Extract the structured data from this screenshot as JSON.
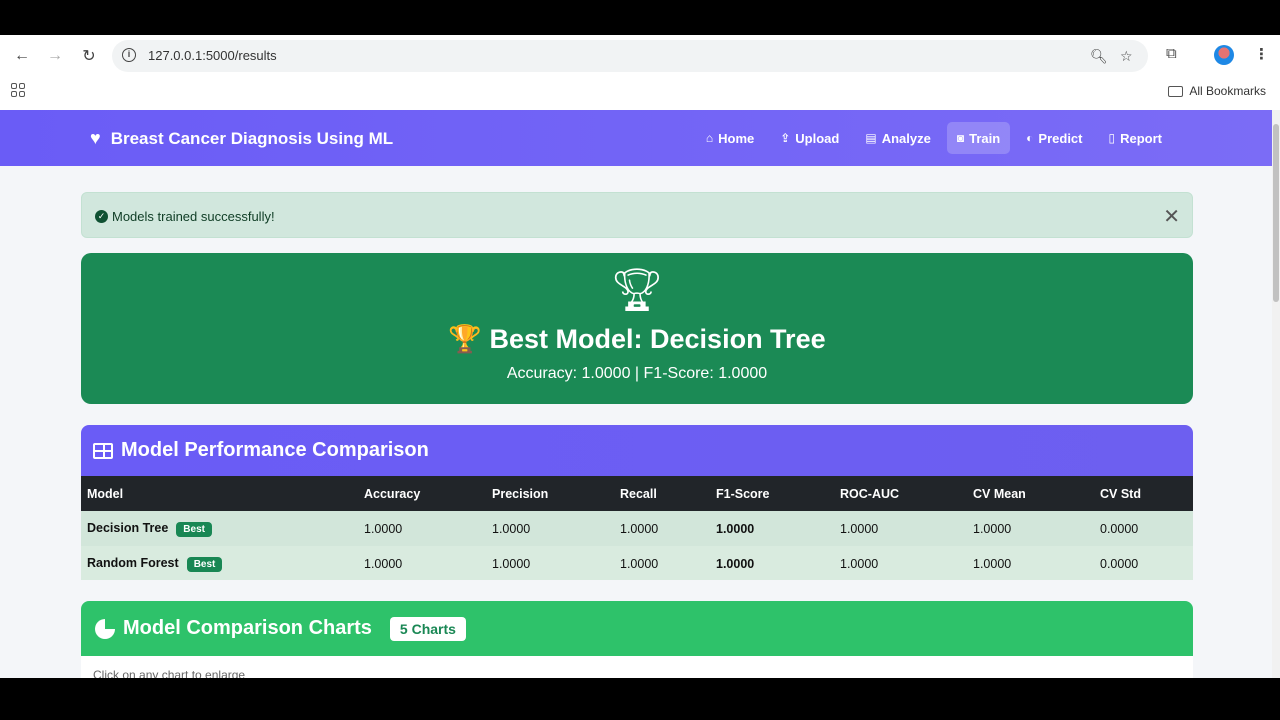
{
  "browser": {
    "url": "127.0.0.1:5000/results",
    "bookmarks_label": "All Bookmarks"
  },
  "app": {
    "brand": "Breast Cancer Diagnosis Using ML",
    "menu": [
      {
        "label": "Home",
        "icon": "home-icon"
      },
      {
        "label": "Upload",
        "icon": "upload-icon"
      },
      {
        "label": "Analyze",
        "icon": "chart-icon"
      },
      {
        "label": "Train",
        "icon": "robot-icon",
        "active": true
      },
      {
        "label": "Predict",
        "icon": "brain-icon"
      },
      {
        "label": "Report",
        "icon": "file-icon"
      }
    ]
  },
  "alert": {
    "message": "Models trained successfully!"
  },
  "best_model": {
    "title": "🏆 Best Model: Decision Tree",
    "subtitle": "Accuracy: 1.0000 | F1-Score: 1.0000"
  },
  "performance": {
    "title": "Model Performance Comparison",
    "columns": [
      "Model",
      "Accuracy",
      "Precision",
      "Recall",
      "F1-Score",
      "ROC-AUC",
      "CV Mean",
      "CV Std"
    ],
    "rows": [
      {
        "model": "Decision Tree",
        "badge": "Best",
        "accuracy": "1.0000",
        "precision": "1.0000",
        "recall": "1.0000",
        "f1": "1.0000",
        "roc_auc": "1.0000",
        "cv_mean": "1.0000",
        "cv_std": "0.0000"
      },
      {
        "model": "Random Forest",
        "badge": "Best",
        "accuracy": "1.0000",
        "precision": "1.0000",
        "recall": "1.0000",
        "f1": "1.0000",
        "roc_auc": "1.0000",
        "cv_mean": "1.0000",
        "cv_std": "0.0000"
      }
    ]
  },
  "charts": {
    "title": "Model Comparison Charts",
    "count_badge": "5 Charts",
    "hint": "Click on any chart to enlarge"
  },
  "colors": {
    "primary": "#6a5cf6",
    "success": "#1b8a55",
    "charts_header": "#2ec26a"
  }
}
